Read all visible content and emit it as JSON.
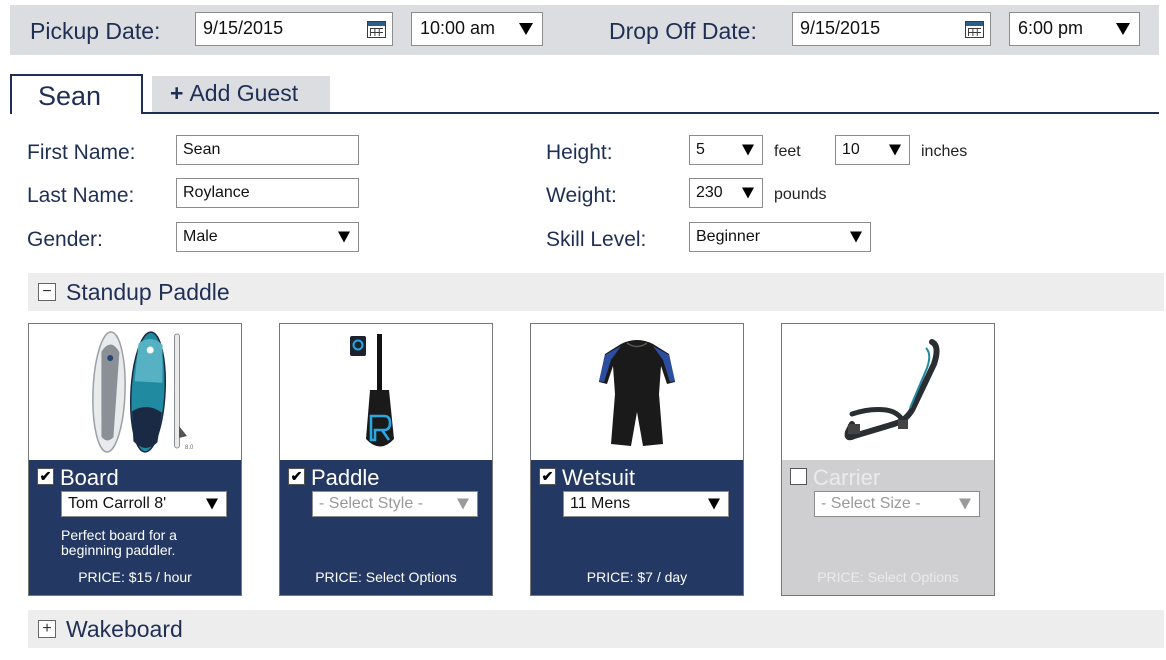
{
  "dates": {
    "pickup_label": "Pickup Date:",
    "pickup_date": "9/15/2015",
    "pickup_time": "10:00 am",
    "dropoff_label": "Drop Off Date:",
    "dropoff_date": "9/15/2015",
    "dropoff_time": "6:00 pm"
  },
  "tabs": {
    "active_guest": "Sean",
    "add_guest_label": "Add Guest"
  },
  "form": {
    "first_name_label": "First Name:",
    "first_name": "Sean",
    "last_name_label": "Last Name:",
    "last_name": "Roylance",
    "gender_label": "Gender:",
    "gender": "Male",
    "height_label": "Height:",
    "height_feet": "5",
    "feet_unit": "feet",
    "height_inches": "10",
    "inches_unit": "inches",
    "weight_label": "Weight:",
    "weight": "230",
    "weight_unit": "pounds",
    "skill_label": "Skill Level:",
    "skill": "Beginner"
  },
  "sections": {
    "standup_title": "Standup Paddle",
    "standup_toggle": "−",
    "wakeboard_title": "Wakeboard",
    "wakeboard_toggle": "+"
  },
  "cards": [
    {
      "name": "Board",
      "checked": true,
      "select": "Tom Carroll 8'",
      "description": "Perfect board for a beginning paddler.",
      "price": "PRICE: $15 / hour",
      "icon": "paddleboard-image"
    },
    {
      "name": "Paddle",
      "checked": true,
      "select": "- Select Style -",
      "description": "",
      "price": "PRICE: Select Options",
      "icon": "paddle-image"
    },
    {
      "name": "Wetsuit",
      "checked": true,
      "select": "11 Mens",
      "description": "",
      "price": "PRICE: $7 / day",
      "icon": "wetsuit-image"
    },
    {
      "name": "Carrier",
      "checked": false,
      "select": "- Select Size -",
      "description": "",
      "price": "PRICE: Select Options",
      "icon": "carrier-strap-image"
    }
  ],
  "colors": {
    "navy": "#233862",
    "text_navy": "#1f2f54",
    "bar_gray": "#dcdde1",
    "disabled_gray": "#cfcfd2",
    "teal": "#1f8aa0"
  }
}
